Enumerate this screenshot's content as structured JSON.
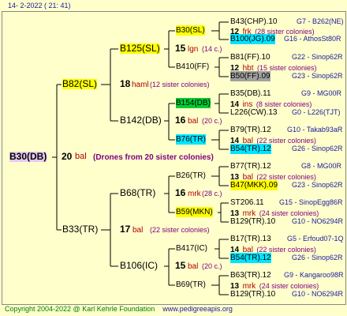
{
  "header": {
    "date_time": "14-  2-2022 ( 21: 41)"
  },
  "root": {
    "label": "B30(DB)",
    "num": "20",
    "gender": "bal",
    "drones": "(Drones from 20 sister colonies)"
  },
  "gen1": [
    {
      "label": "B82(SL)",
      "num": "18",
      "gender": "haml",
      "count": "(12 sister colonies)"
    },
    {
      "label": "B33(TR)",
      "num": "17",
      "gender": "bal",
      "count": "(22 sister colonies)"
    }
  ],
  "gen2": [
    {
      "label": "B125(SL)",
      "num": "15",
      "gender": "lgn",
      "count": "(14 c.)"
    },
    {
      "label": "B142(DB)",
      "num": "16",
      "gender": "bal",
      "count": "(20 c.)"
    },
    {
      "label": "B68(TR)",
      "num": "16",
      "gender": "mrk",
      "count": "(28 c.)"
    },
    {
      "label": "B106(IC)",
      "num": "15",
      "gender": "bal",
      "count": "(20 c.)"
    }
  ],
  "gen3": [
    {
      "label": "B30(SL)",
      "num": "12",
      "gender": "frk",
      "count": "(28 sister colonies)"
    },
    {
      "label": "B410(FF)",
      "num": "12",
      "gender": "hbt",
      "count": "(15 sister colonies)"
    },
    {
      "label": "B154(DB)",
      "num": "14",
      "gender": "ins",
      "count": "(8 sister colonies)"
    },
    {
      "label": "B76(TR)",
      "num": "14",
      "gender": "bal",
      "count": "(22 sister colonies)"
    },
    {
      "label": "B26(TR)",
      "num": "13",
      "gender": "bal",
      "count": "(22 sister colonies)"
    },
    {
      "label": "B59(MKN)",
      "num": "13",
      "gender": "mrk",
      "count": "(24 sister colonies)"
    },
    {
      "label": "B417(IC)",
      "num": "14",
      "gender": "bal",
      "count": "(22 sister colonies)"
    },
    {
      "label": "B69(TR)",
      "num": "13",
      "gender": "mrk",
      "count": "(24 sister colonies)"
    }
  ],
  "gen4": [
    {
      "label": "B43(CHP).10",
      "parents": "G7 - B262(NE)"
    },
    {
      "label": "B100(JG).09",
      "parents": "G16 - AthosSt80R"
    },
    {
      "label": "B81(FF).10",
      "parents": "G22 - Sinop62R"
    },
    {
      "label": "B50(FF).09",
      "parents": "G23 - Sinop62R"
    },
    {
      "label": "B35(DB).11",
      "parents": "G9 - MG00R"
    },
    {
      "label": "L226(CW).13",
      "parents": "G0 - L226(TJT)"
    },
    {
      "label": "B79(TR).12",
      "parents": "G10 - Takab93aR"
    },
    {
      "label": "B54(TR).12",
      "parents": "G26 - Sinop62R"
    },
    {
      "label": "B77(TR).12",
      "parents": "G8 - MG00R"
    },
    {
      "label": "B47(MKK).09",
      "parents": "G23 - Sinop62R"
    },
    {
      "label": "ST206.11",
      "parents": "G15 - SinopEgg86R"
    },
    {
      "label": "B129(TR).10",
      "parents": "G10 - NO6294R"
    },
    {
      "label": "B17(TR).13",
      "parents": "G5 - Erfoud07-1Q"
    },
    {
      "label": "B54(TR).12",
      "parents": "G26 - Sinop62R"
    },
    {
      "label": "B63(TR).12",
      "parents": "G9 - Kangaroo98R"
    },
    {
      "label": "B129(TR).10",
      "parents": "G10 - NO6294R"
    }
  ],
  "footer": {
    "copyright": "Copyright 2004-2022 @ Karl Kehrle Foundation",
    "url": "www.pedigreeapis.org"
  }
}
